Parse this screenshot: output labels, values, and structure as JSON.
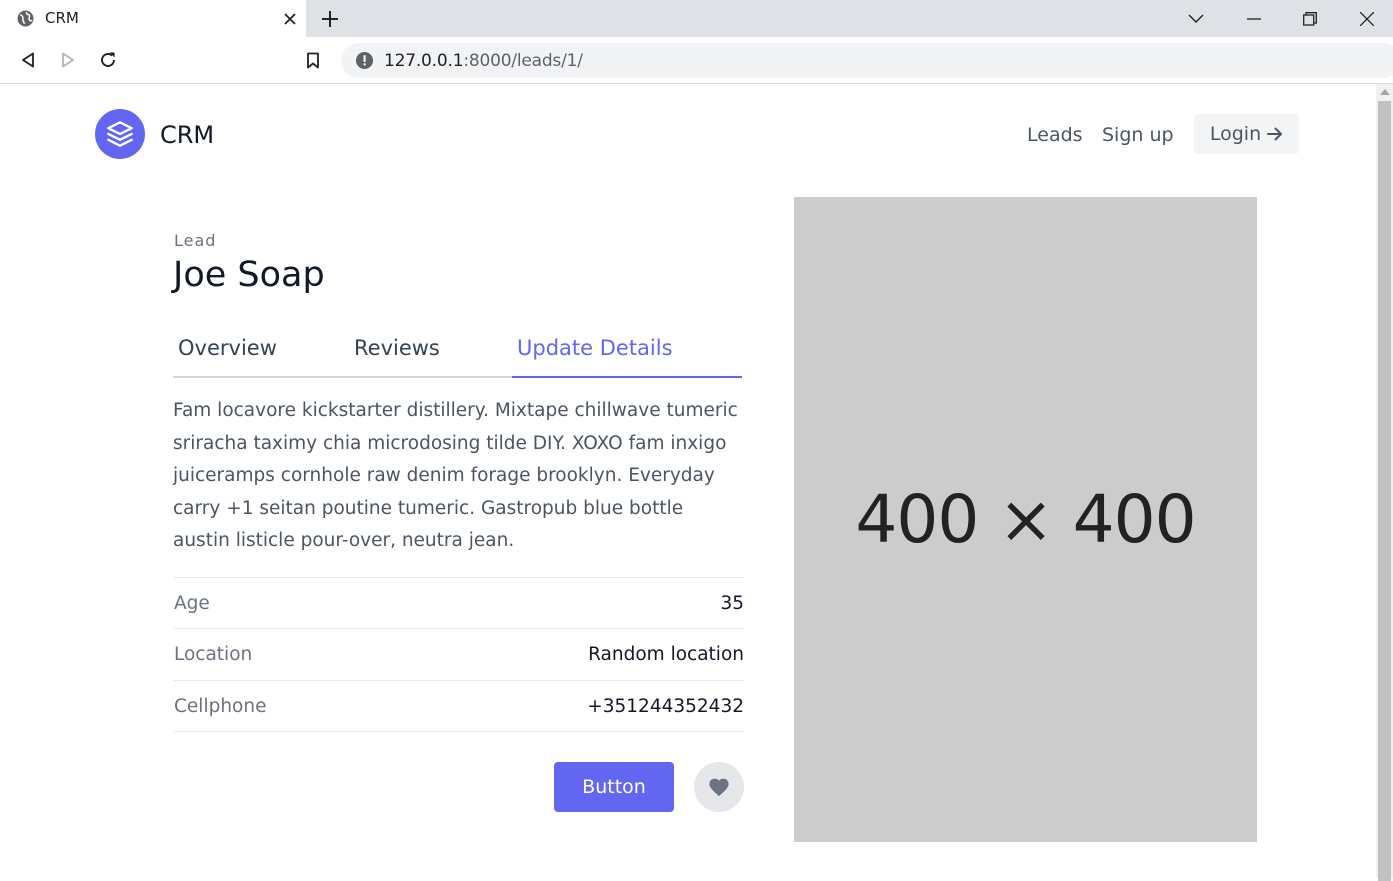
{
  "browser": {
    "tab_title": "CRM",
    "url_host": "127.0.0.1",
    "url_rest": ":8000/leads/1/"
  },
  "nav": {
    "brand": "CRM",
    "links": [
      "Leads",
      "Sign up"
    ],
    "login_label": "Login"
  },
  "lead": {
    "eyebrow": "Lead",
    "name": "Joe Soap",
    "tabs": [
      "Overview",
      "Reviews",
      "Update Details"
    ],
    "active_tab": "Update Details",
    "description": "Fam locavore kickstarter distillery. Mixtape chillwave tumeric sriracha taximy chia microdosing tilde DIY. XOXO fam inxigo juiceramps cornhole raw denim forage brooklyn. Everyday carry +1 seitan poutine tumeric. Gastropub blue bottle austin listicle pour-over, neutra jean.",
    "fields": [
      {
        "label": "Age",
        "value": "35"
      },
      {
        "label": "Location",
        "value": "Random location"
      },
      {
        "label": "Cellphone",
        "value": "+351244352432"
      }
    ],
    "button_label": "Button"
  },
  "image": {
    "placeholder_text": "400 × 400"
  },
  "colors": {
    "accent": "#6366f1",
    "placeholder_bg": "#cccccc"
  }
}
